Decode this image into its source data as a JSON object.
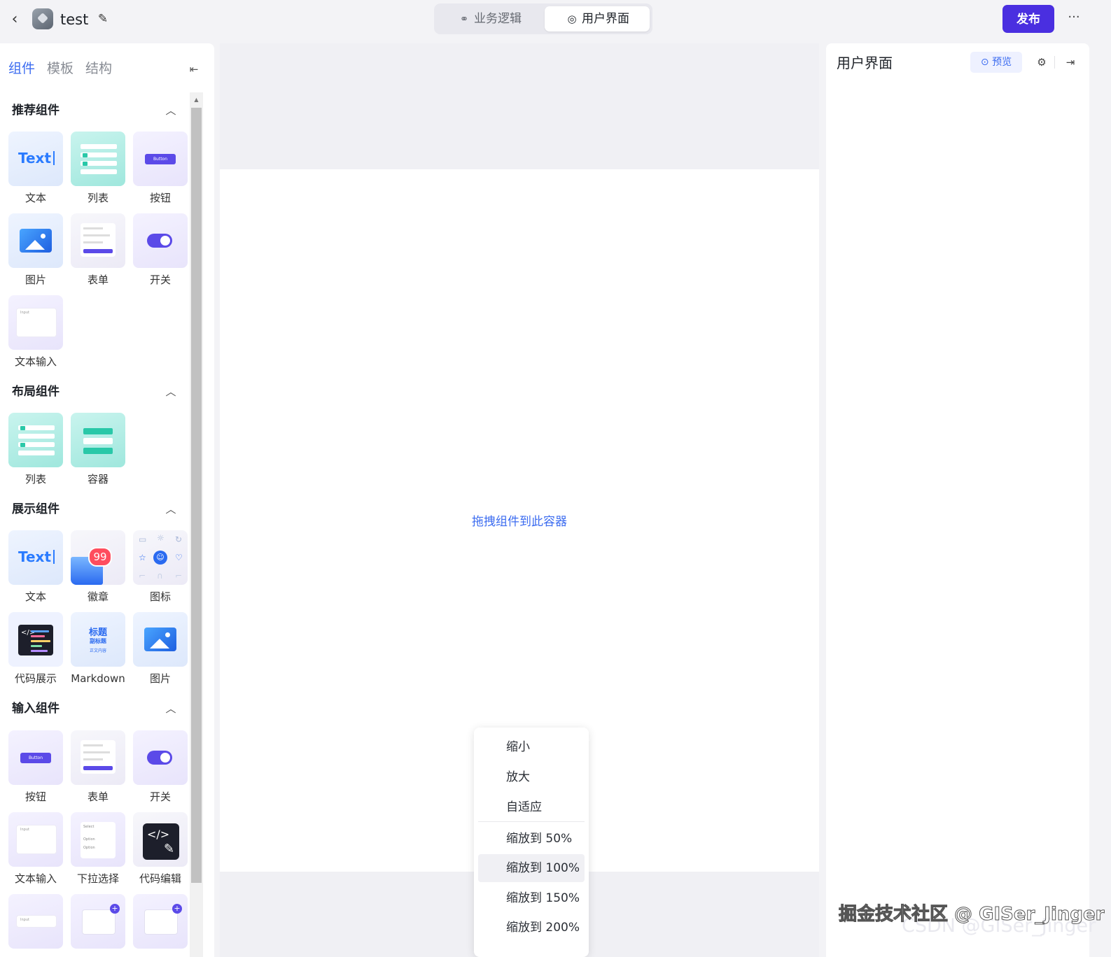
{
  "header": {
    "back_icon": "chevron-left-icon",
    "app_title": "test",
    "edit_icon": "edit-icon",
    "segments": [
      {
        "label": "业务逻辑",
        "icon": "flow-icon",
        "active": false
      },
      {
        "label": "用户界面",
        "icon": "palette-icon",
        "active": true
      }
    ],
    "publish_label": "发布",
    "more_label": "···"
  },
  "left_panel": {
    "tabs": [
      {
        "label": "组件",
        "active": true
      },
      {
        "label": "模板",
        "active": false
      },
      {
        "label": "结构",
        "active": false
      }
    ],
    "sections": [
      {
        "title": "推荐组件",
        "items": [
          "文本",
          "列表",
          "按钮",
          "图片",
          "表单",
          "开关",
          "文本输入"
        ]
      },
      {
        "title": "布局组件",
        "items": [
          "列表",
          "容器"
        ]
      },
      {
        "title": "展示组件",
        "items": [
          "文本",
          "徽章",
          "图标",
          "代码展示",
          "Markdown",
          "图片"
        ]
      },
      {
        "title": "输入组件",
        "items": [
          "按钮",
          "表单",
          "开关",
          "文本输入",
          "下拉选择",
          "代码编辑"
        ]
      }
    ],
    "thumb_text": {
      "text": "Text",
      "button": "Button",
      "badge_count": "99",
      "md_title": "标题",
      "md_subtitle": "副标题",
      "md_body": "正文内容",
      "select": "Select",
      "option": "Option"
    }
  },
  "canvas": {
    "drop_hint": "拖拽组件到此容器"
  },
  "zoom_menu": {
    "items": [
      "缩小",
      "放大",
      "自适应",
      "缩放到 50%",
      "缩放到 100%",
      "缩放到 150%",
      "缩放到 200%"
    ],
    "selected": "缩放到 100%"
  },
  "right_panel": {
    "title": "用户界面",
    "preview_label": "预览",
    "settings_icon": "gear-icon",
    "expand_icon": "expand-icon"
  },
  "watermark": {
    "line1": "掘金技术社区 @ GISer_Jinger",
    "line2": "CSDN @GISer_Jinger"
  }
}
